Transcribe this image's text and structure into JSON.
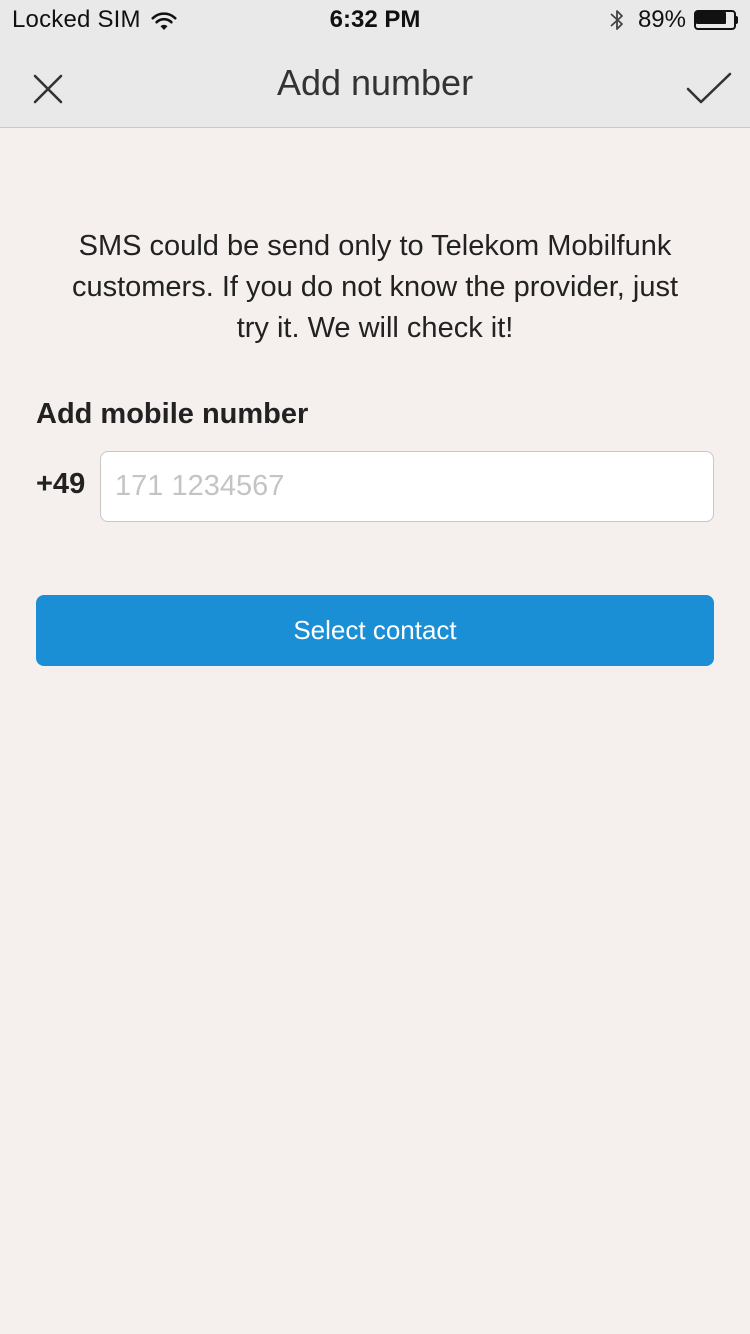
{
  "status_bar": {
    "carrier": "Locked SIM",
    "time": "6:32 PM",
    "battery_percent_text": "89%",
    "battery_level": 0.89,
    "icons": [
      "wifi-icon",
      "bluetooth-icon",
      "battery-icon"
    ]
  },
  "nav": {
    "title": "Add number",
    "close_icon": "close-icon",
    "confirm_icon": "checkmark-icon"
  },
  "main": {
    "info_text": "SMS could be send only to Telekom Mobilfunk customers. If you do not know the provider, just try it. We will check it!",
    "field_label": "Add mobile number",
    "country_code": "+49",
    "phone_input": {
      "value": "",
      "placeholder": "171 1234567"
    },
    "select_contact_label": "Select contact"
  },
  "colors": {
    "accent": "#1a8fd6",
    "background": "#f5f0ed",
    "nav_background": "#e9e9e9"
  }
}
